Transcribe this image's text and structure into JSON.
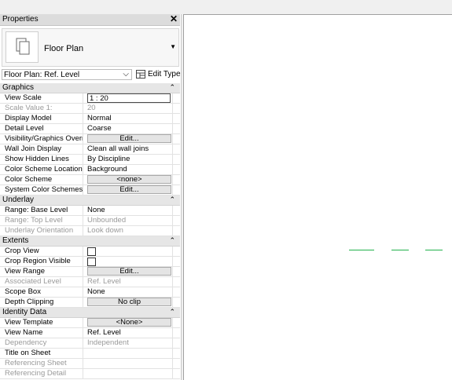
{
  "palette": {
    "title": "Properties",
    "close_glyph": "✕",
    "type_name": "Floor Plan",
    "type_icon": "floor-plan-icon",
    "instance_filter": "Floor Plan: Ref. Level",
    "edit_type_label": "Edit Type"
  },
  "groups": {
    "graphics": "Graphics",
    "underlay": "Underlay",
    "extents": "Extents",
    "identity": "Identity Data"
  },
  "props": {
    "view_scale": {
      "name": "View Scale",
      "value": "1 : 20"
    },
    "scale_value": {
      "name": "Scale Value    1:",
      "value": "20"
    },
    "display_model": {
      "name": "Display Model",
      "value": "Normal"
    },
    "detail_level": {
      "name": "Detail Level",
      "value": "Coarse"
    },
    "visibility": {
      "name": "Visibility/Graphics Overri...",
      "value": "Edit..."
    },
    "wall_join": {
      "name": "Wall Join Display",
      "value": "Clean all wall joins"
    },
    "hidden_lines": {
      "name": "Show Hidden Lines",
      "value": "By Discipline"
    },
    "color_scheme_location": {
      "name": "Color Scheme Location",
      "value": "Background"
    },
    "color_scheme": {
      "name": "Color Scheme",
      "value": "<none>"
    },
    "system_color": {
      "name": "System Color Schemes",
      "value": "Edit..."
    },
    "range_base": {
      "name": "Range: Base Level",
      "value": "None"
    },
    "range_top": {
      "name": "Range: Top Level",
      "value": "Unbounded"
    },
    "underlay_orientation": {
      "name": "Underlay Orientation",
      "value": "Look down"
    },
    "crop_view": {
      "name": "Crop View",
      "checked": false
    },
    "crop_region": {
      "name": "Crop Region Visible",
      "checked": false
    },
    "view_range": {
      "name": "View Range",
      "value": "Edit..."
    },
    "associated_level": {
      "name": "Associated Level",
      "value": "Ref. Level"
    },
    "scope_box": {
      "name": "Scope Box",
      "value": "None"
    },
    "depth_clipping": {
      "name": "Depth Clipping",
      "value": "No clip"
    },
    "view_template": {
      "name": "View Template",
      "value": "<None>"
    },
    "view_name": {
      "name": "View Name",
      "value": "Ref. Level"
    },
    "dependency": {
      "name": "Dependency",
      "value": "Independent"
    },
    "title_on_sheet": {
      "name": "Title on Sheet",
      "value": ""
    },
    "referencing_sheet": {
      "name": "Referencing Sheet",
      "value": ""
    },
    "referencing_detail": {
      "name": "Referencing Detail",
      "value": ""
    }
  },
  "colors": {
    "accent_line": "#22b14c"
  }
}
